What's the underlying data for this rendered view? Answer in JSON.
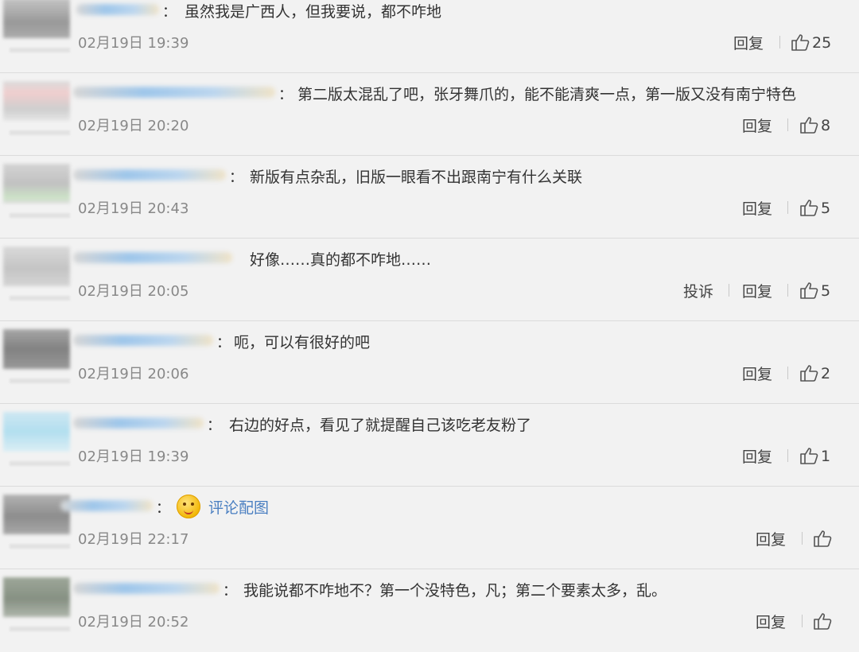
{
  "comments": [
    {
      "text": "虽然我是广西人，但我要说，都不咋地",
      "time": "02月19日 19:39",
      "reply_label": "回复",
      "likes": "25"
    },
    {
      "text": "第二版太混乱了吧，张牙舞爪的，能不能清爽一点，第一版又没有南宁特色",
      "time": "02月19日 20:20",
      "reply_label": "回复",
      "likes": "8"
    },
    {
      "text": "新版有点杂乱，旧版一眼看不出跟南宁有什么关联",
      "time": "02月19日 20:43",
      "reply_label": "回复",
      "likes": "5"
    },
    {
      "text": "好像……真的都不咋地……",
      "time": "02月19日 20:05",
      "report_label": "投诉",
      "reply_label": "回复",
      "likes": "5"
    },
    {
      "text": "呃，可以有很好的吧",
      "time": "02月19日 20:06",
      "reply_label": "回复",
      "likes": "2"
    },
    {
      "text": "右边的好点，看见了就提醒自己该吃老友粉了",
      "time": "02月19日 19:39",
      "reply_label": "回复",
      "likes": "1"
    },
    {
      "text": "评论配图",
      "emoji_icon": "yummy-face-icon",
      "time": "02月19日 22:17",
      "reply_label": "回复",
      "likes": ""
    },
    {
      "text": "我能说都不咋地不？第一个没特色，凡；第二个要素太多，乱。",
      "time": "02月19日 20:52",
      "reply_label": "回复",
      "likes": ""
    }
  ],
  "colon": "：",
  "colors": {
    "link": "#4a7fc1",
    "text": "#333333",
    "meta": "#888888",
    "background": "#f2f2f2"
  }
}
